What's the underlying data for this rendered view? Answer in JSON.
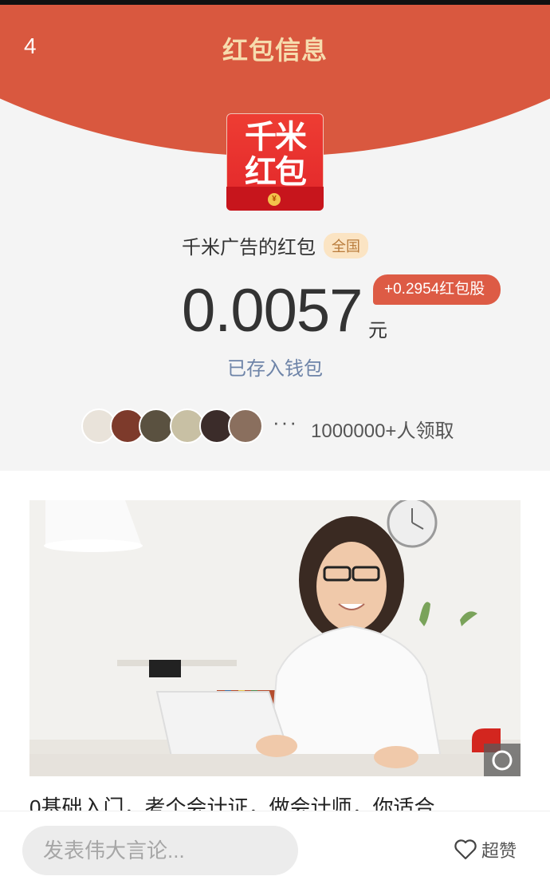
{
  "header": {
    "back_count": "4",
    "title": "红包信息"
  },
  "packet": {
    "logo_text": "千米红包",
    "sender": "千米广告的红包",
    "region": "全国",
    "amount": "0.0057",
    "unit": "元",
    "bonus": "+0.2954红包股",
    "saved_text": "已存入钱包"
  },
  "receivers": {
    "more": "···",
    "count_text": "1000000+人领取",
    "avatar_colors": [
      "#e9e3da",
      "#7d3a2b",
      "#5a5140",
      "#c8c0a4",
      "#3b2c2a",
      "#8a6f5e"
    ]
  },
  "ad": {
    "title": "0基础入门，考个会计证，做会计师，你适合",
    "accent": "#d9583f"
  },
  "footer": {
    "placeholder": "发表伟大言论...",
    "like_label": "超赞"
  },
  "colors": {
    "brand": "#d9583f",
    "title_gold": "#f6dcae",
    "link": "#6e84a8",
    "badge_bg": "#fbe4c3"
  }
}
